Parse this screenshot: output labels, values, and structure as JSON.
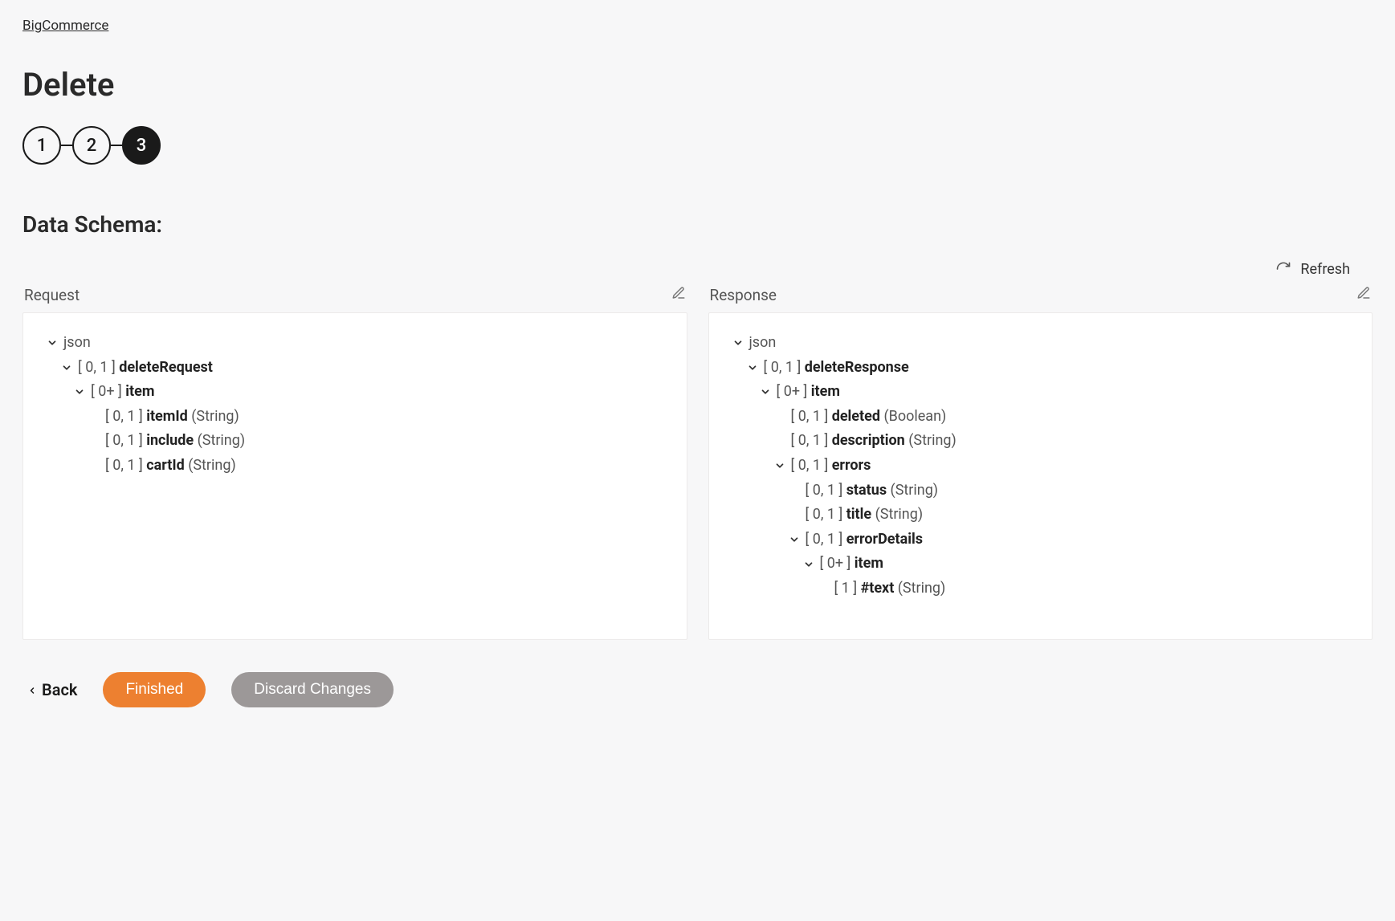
{
  "breadcrumb": "BigCommerce",
  "page_title": "Delete",
  "stepper": {
    "steps": [
      "1",
      "2",
      "3"
    ],
    "active_index": 2
  },
  "section_title": "Data Schema:",
  "refresh_label": "Refresh",
  "panels": {
    "request": {
      "title": "Request",
      "tree": [
        {
          "indent": 0,
          "chevron": true,
          "cardinality": "",
          "name": "json",
          "type": ""
        },
        {
          "indent": 1,
          "chevron": true,
          "cardinality": "[ 0, 1 ]",
          "name": "deleteRequest",
          "type": ""
        },
        {
          "indent": 2,
          "chevron": true,
          "cardinality": "[ 0+ ]",
          "name": "item",
          "type": ""
        },
        {
          "indent": 3,
          "chevron": false,
          "cardinality": "[ 0, 1 ]",
          "name": "itemId",
          "type": "(String)"
        },
        {
          "indent": 3,
          "chevron": false,
          "cardinality": "[ 0, 1 ]",
          "name": "include",
          "type": "(String)"
        },
        {
          "indent": 3,
          "chevron": false,
          "cardinality": "[ 0, 1 ]",
          "name": "cartId",
          "type": "(String)"
        }
      ]
    },
    "response": {
      "title": "Response",
      "tree": [
        {
          "indent": 0,
          "chevron": true,
          "cardinality": "",
          "name": "json",
          "type": ""
        },
        {
          "indent": 1,
          "chevron": true,
          "cardinality": "[ 0, 1 ]",
          "name": "deleteResponse",
          "type": ""
        },
        {
          "indent": 2,
          "chevron": true,
          "cardinality": "[ 0+ ]",
          "name": "item",
          "type": ""
        },
        {
          "indent": 3,
          "chevron": false,
          "cardinality": "[ 0, 1 ]",
          "name": "deleted",
          "type": "(Boolean)"
        },
        {
          "indent": 3,
          "chevron": false,
          "cardinality": "[ 0, 1 ]",
          "name": "description",
          "type": "(String)"
        },
        {
          "indent": 3,
          "chevron": true,
          "cardinality": "[ 0, 1 ]",
          "name": "errors",
          "type": ""
        },
        {
          "indent": 4,
          "chevron": false,
          "cardinality": "[ 0, 1 ]",
          "name": "status",
          "type": "(String)"
        },
        {
          "indent": 4,
          "chevron": false,
          "cardinality": "[ 0, 1 ]",
          "name": "title",
          "type": "(String)"
        },
        {
          "indent": 4,
          "chevron": true,
          "cardinality": "[ 0, 1 ]",
          "name": "errorDetails",
          "type": ""
        },
        {
          "indent": 5,
          "chevron": true,
          "cardinality": "[ 0+ ]",
          "name": "item",
          "type": ""
        },
        {
          "indent": 6,
          "chevron": false,
          "cardinality": "[ 1 ]",
          "name": "#text",
          "type": "(String)"
        }
      ]
    }
  },
  "footer": {
    "back": "Back",
    "finished": "Finished",
    "discard": "Discard Changes"
  }
}
